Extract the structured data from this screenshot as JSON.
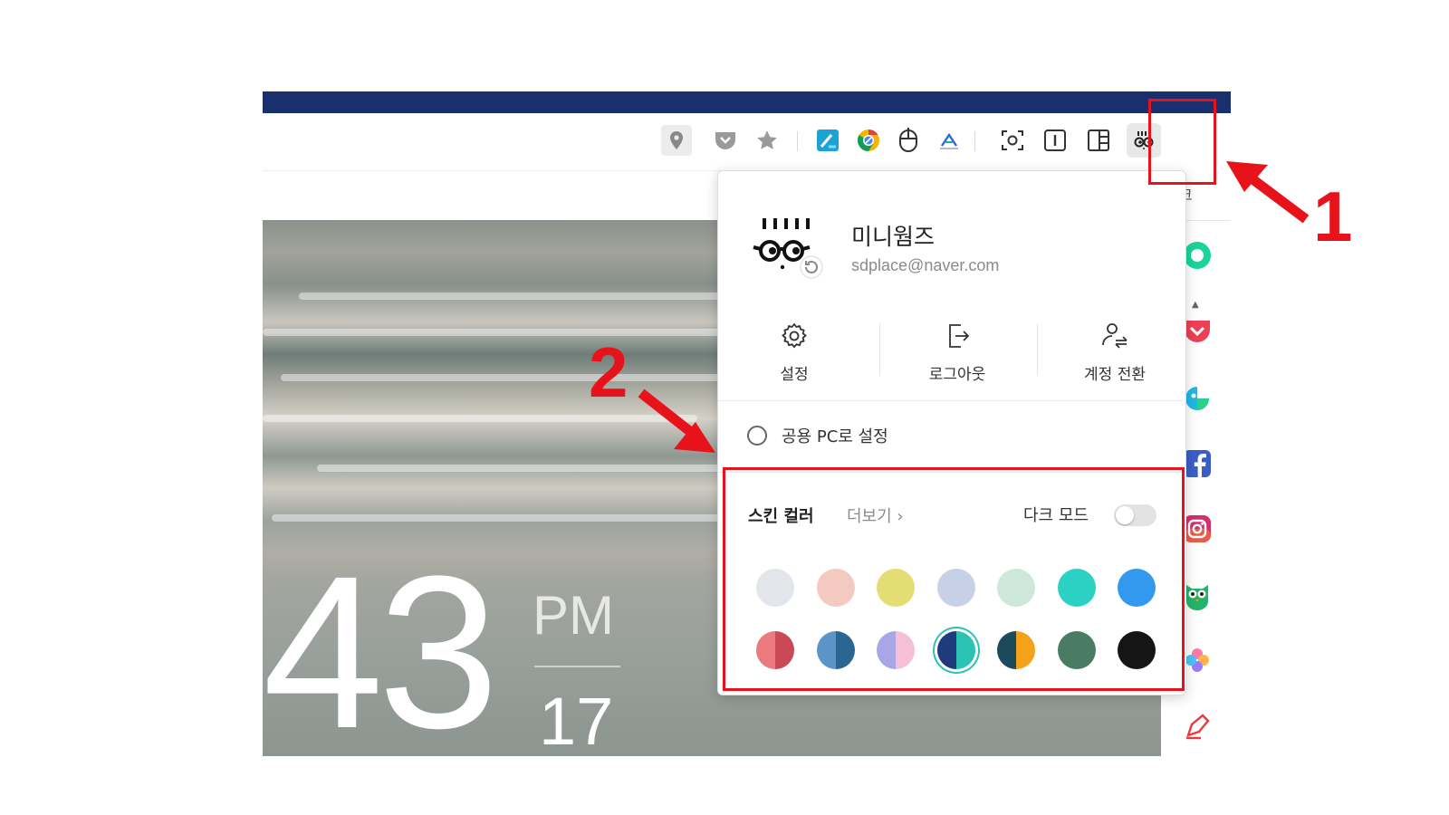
{
  "toolbar": {
    "icons": [
      "location-pin-icon",
      "pocket-icon",
      "bookmark-star-icon",
      "papago-icon",
      "chrome-like-icon",
      "mouse-gesture-icon",
      "translate-icon",
      "screen-capture-icon",
      "reader-mode-icon",
      "split-view-icon",
      "profile-icon"
    ]
  },
  "clock": {
    "minutes": "43",
    "ampm": "PM",
    "seconds": "17"
  },
  "sidebar": {
    "partial_label": "크",
    "icons": [
      "green-circle-icon",
      "pocket-icon",
      "papago-icon",
      "facebook-icon",
      "instagram-icon",
      "owl-icon",
      "clover-icon",
      "pen-icon"
    ]
  },
  "profile": {
    "name": "미니웜즈",
    "email": "sdplace@naver.com",
    "avatar_icon": "minikeyboard-glasses-avatar-icon"
  },
  "actions": [
    {
      "label": "설정",
      "icon": "gear-icon"
    },
    {
      "label": "로그아웃",
      "icon": "logout-icon"
    },
    {
      "label": "계정 전환",
      "icon": "account-switch-icon"
    }
  ],
  "public_pc": {
    "label": "공용 PC로 설정",
    "checked": false
  },
  "skin": {
    "title": "스킨 컬러",
    "more_label": "더보기 ›",
    "dark_mode_label": "다크 모드",
    "dark_mode_on": false,
    "colors_row1": [
      "#e3e6ea",
      "#f3c9c0",
      "#e3dd73",
      "#c6d1e8",
      "#cde7da",
      "#2bd2c3",
      "#3399ef"
    ],
    "colors_row2": [
      [
        "#ea7a80",
        "#c94a55"
      ],
      [
        "#5b95c8",
        "#2b6693"
      ],
      [
        "#a9a6e8",
        "#f5c0d6"
      ],
      [
        "#1f3a7d",
        "#2bc3b3"
      ],
      [
        "#1a4a5c",
        "#f5a21b"
      ],
      [
        "#4a7c63",
        "#4a7c63"
      ],
      [
        "#151515",
        "#151515"
      ]
    ],
    "selected_index_row2": 3
  },
  "annotations": {
    "marker1": "1",
    "marker2": "2",
    "color": "#e8131a"
  }
}
